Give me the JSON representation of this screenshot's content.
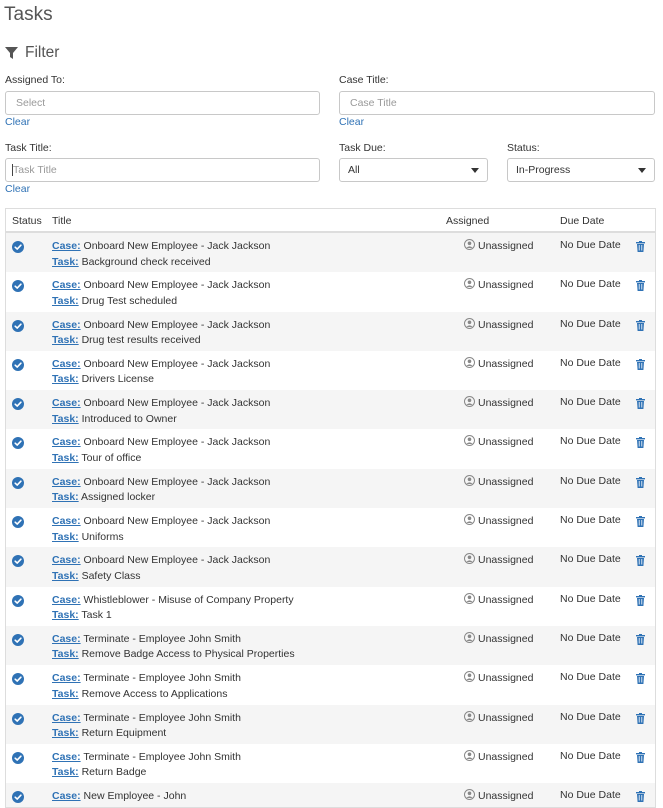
{
  "page": {
    "title": "Tasks"
  },
  "filter": {
    "heading": "Filter",
    "assigned_to": {
      "label": "Assigned To:",
      "placeholder": "Select",
      "clear": "Clear"
    },
    "case_title": {
      "label": "Case Title:",
      "placeholder": "Case Title",
      "clear": "Clear"
    },
    "task_title": {
      "label": "Task Title:",
      "placeholder": "Task Title",
      "clear": "Clear"
    },
    "task_due": {
      "label": "Task Due:",
      "value": "All"
    },
    "status": {
      "label": "Status:",
      "value": "In-Progress"
    }
  },
  "table": {
    "headers": {
      "status": "Status",
      "title": "Title",
      "assigned": "Assigned",
      "due": "Due Date"
    },
    "case_label": "Case:",
    "task_label": "Task:",
    "rows": [
      {
        "case": "Onboard New Employee - Jack Jackson",
        "task": "Background check received",
        "assigned": "Unassigned",
        "due": "No Due Date"
      },
      {
        "case": "Onboard New Employee - Jack Jackson",
        "task": "Drug Test scheduled",
        "assigned": "Unassigned",
        "due": "No Due Date"
      },
      {
        "case": "Onboard New Employee - Jack Jackson",
        "task": "Drug test results received",
        "assigned": "Unassigned",
        "due": "No Due Date"
      },
      {
        "case": "Onboard New Employee - Jack Jackson",
        "task": "Drivers License",
        "assigned": "Unassigned",
        "due": "No Due Date"
      },
      {
        "case": "Onboard New Employee - Jack Jackson",
        "task": "Introduced to Owner",
        "assigned": "Unassigned",
        "due": "No Due Date"
      },
      {
        "case": "Onboard New Employee - Jack Jackson",
        "task": "Tour of office",
        "assigned": "Unassigned",
        "due": "No Due Date"
      },
      {
        "case": "Onboard New Employee - Jack Jackson",
        "task": "Assigned locker",
        "assigned": "Unassigned",
        "due": "No Due Date"
      },
      {
        "case": "Onboard New Employee - Jack Jackson",
        "task": "Uniforms",
        "assigned": "Unassigned",
        "due": "No Due Date"
      },
      {
        "case": "Onboard New Employee - Jack Jackson",
        "task": "Safety Class",
        "assigned": "Unassigned",
        "due": "No Due Date"
      },
      {
        "case": "Whistleblower - Misuse of Company Property",
        "task": "Task 1",
        "assigned": "Unassigned",
        "due": "No Due Date"
      },
      {
        "case": "Terminate - Employee John Smith",
        "task": "Remove Badge Access to Physical Properties",
        "assigned": "Unassigned",
        "due": "No Due Date"
      },
      {
        "case": "Terminate - Employee John Smith",
        "task": "Remove Access to Applications",
        "assigned": "Unassigned",
        "due": "No Due Date"
      },
      {
        "case": "Terminate - Employee John Smith",
        "task": "Return Equipment",
        "assigned": "Unassigned",
        "due": "No Due Date"
      },
      {
        "case": "Terminate - Employee John Smith",
        "task": "Return Badge",
        "assigned": "Unassigned",
        "due": "No Due Date"
      },
      {
        "case": "New Employee - John",
        "task": "",
        "assigned": "Unassigned",
        "due": "No Due Date"
      }
    ]
  },
  "icons": {
    "filter": "filter-funnel-icon",
    "status": "check-circle-icon",
    "user": "user-circle-icon",
    "delete": "trash-icon"
  },
  "colors": {
    "link": "#2f72b5",
    "status_check": "#2f72b5",
    "stripe": "#f5f5f5"
  }
}
